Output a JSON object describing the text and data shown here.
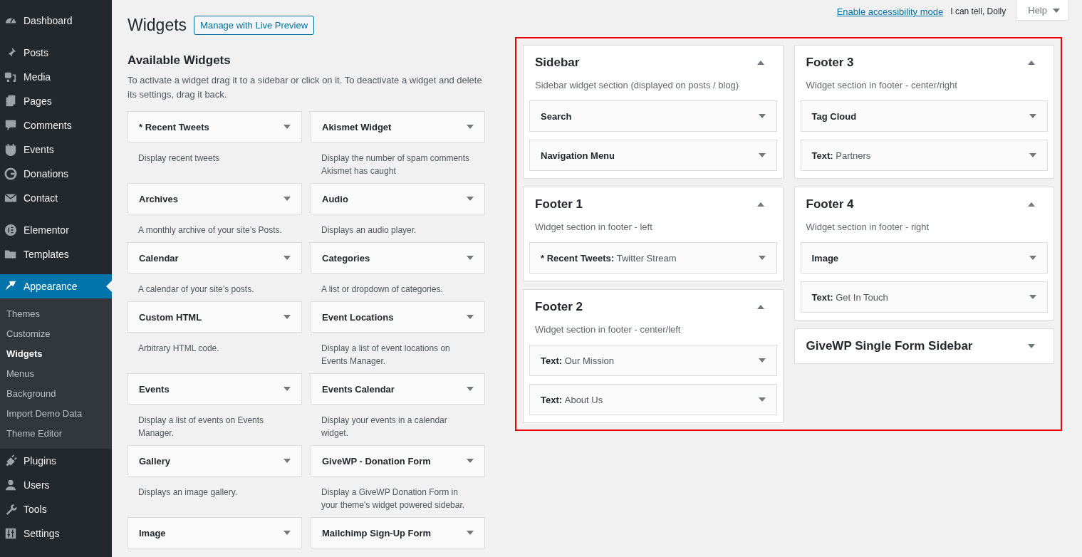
{
  "menu": [
    [
      {
        "label": "Dashboard",
        "selected": false
      }
    ],
    [
      {
        "label": "Posts",
        "selected": false
      },
      {
        "label": "Media",
        "selected": false
      },
      {
        "label": "Pages",
        "selected": false
      },
      {
        "label": "Comments",
        "selected": false
      },
      {
        "label": "Events",
        "selected": false
      },
      {
        "label": "Donations",
        "selected": false
      },
      {
        "label": "Contact",
        "selected": false
      }
    ],
    [
      {
        "label": "Elementor",
        "selected": false
      },
      {
        "label": "Templates",
        "selected": false
      }
    ],
    [
      {
        "label": "Appearance",
        "selected": true,
        "children": [
          {
            "label": "Themes",
            "selected": false
          },
          {
            "label": "Customize",
            "selected": false
          },
          {
            "label": "Widgets",
            "selected": true
          },
          {
            "label": "Menus",
            "selected": false
          },
          {
            "label": "Background",
            "selected": false
          },
          {
            "label": "Import Demo Data",
            "selected": false
          },
          {
            "label": "Theme Editor",
            "selected": false
          }
        ]
      },
      {
        "label": "Plugins",
        "selected": false
      },
      {
        "label": "Users",
        "selected": false
      },
      {
        "label": "Tools",
        "selected": false
      },
      {
        "label": "Settings",
        "selected": false
      }
    ]
  ],
  "top_bar": {
    "accessibility_link": "Enable accessibility mode",
    "quote": "I can tell, Dolly",
    "help": "Help"
  },
  "page_title": "Widgets",
  "live_preview_button": "Manage with Live Preview",
  "available": {
    "title": "Available Widgets",
    "intro": "To activate a widget drag it to a sidebar or click on it. To deactivate a widget and delete its settings, drag it back.",
    "widgets": [
      {
        "title": "* Recent Tweets",
        "description": "Display recent tweets"
      },
      {
        "title": "Akismet Widget",
        "description": "Display the number of spam comments Akismet has caught"
      },
      {
        "title": "Archives",
        "description": "A monthly archive of your site’s Posts."
      },
      {
        "title": "Audio",
        "description": "Displays an audio player."
      },
      {
        "title": "Calendar",
        "description": "A calendar of your site’s posts."
      },
      {
        "title": "Categories",
        "description": "A list or dropdown of categories."
      },
      {
        "title": "Custom HTML",
        "description": "Arbitrary HTML code."
      },
      {
        "title": "Event Locations",
        "description": "Display a list of event locations on Events Manager."
      },
      {
        "title": "Events",
        "description": "Display a list of events on Events Manager."
      },
      {
        "title": "Events Calendar",
        "description": "Display your events in a calendar widget."
      },
      {
        "title": "Gallery",
        "description": "Displays an image gallery."
      },
      {
        "title": "GiveWP - Donation Form",
        "description": "Display a GiveWP Donation Form in your theme's widget powered sidebar."
      },
      {
        "title": "Image"
      },
      {
        "title": "Mailchimp Sign-Up Form"
      }
    ]
  },
  "areas": [
    [
      {
        "title": "Sidebar",
        "expanded": true,
        "description": "Sidebar widget section (displayed on posts / blog)",
        "widgets": [
          {
            "title": "Search"
          },
          {
            "title": "Navigation Menu"
          }
        ]
      },
      {
        "title": "Footer 1",
        "expanded": true,
        "description": "Widget section in footer - left",
        "widgets": [
          {
            "title": "* Recent Tweets:",
            "instance": "Twitter Stream"
          }
        ]
      },
      {
        "title": "Footer 2",
        "expanded": true,
        "description": "Widget section in footer - center/left",
        "widgets": [
          {
            "title": "Text:",
            "instance": "Our Mission"
          },
          {
            "title": "Text:",
            "instance": "About Us"
          }
        ]
      }
    ],
    [
      {
        "title": "Footer 3",
        "expanded": true,
        "description": "Widget section in footer - center/right",
        "widgets": [
          {
            "title": "Tag Cloud"
          },
          {
            "title": "Text:",
            "instance": "Partners"
          }
        ]
      },
      {
        "title": "Footer 4",
        "expanded": true,
        "description": "Widget section in footer - right",
        "widgets": [
          {
            "title": "Image"
          },
          {
            "title": "Text:",
            "instance": "Get In Touch"
          }
        ]
      },
      {
        "title": "GiveWP Single Form Sidebar",
        "expanded": false
      }
    ]
  ]
}
